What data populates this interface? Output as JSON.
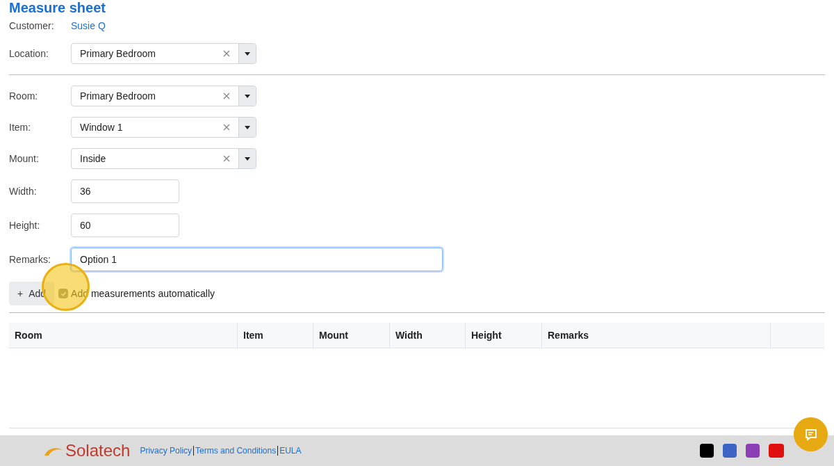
{
  "title": "Measure sheet",
  "customer": {
    "label": "Customer:",
    "value": "Susie Q"
  },
  "location": {
    "label": "Location:",
    "kind": "select",
    "value": "Primary Bedroom",
    "focused": false
  },
  "fields": [
    {
      "label": "Room:",
      "kind": "select",
      "value": "Primary Bedroom",
      "focused": false
    },
    {
      "label": "Item:",
      "kind": "select",
      "value": "Window 1",
      "focused": false
    },
    {
      "label": "Mount:",
      "kind": "select",
      "value": "Inside",
      "focused": false
    },
    {
      "label": "Width:",
      "kind": "short",
      "value": "36",
      "focused": false
    },
    {
      "label": "Height:",
      "kind": "short",
      "value": "60",
      "focused": false
    },
    {
      "label": "Remarks:",
      "kind": "long",
      "value": "Option 1",
      "focused": true
    }
  ],
  "add_button": {
    "icon": "+",
    "label": "Add"
  },
  "auto_checkbox": {
    "label": "Add measurements automatically",
    "checked": true
  },
  "table": {
    "columns": [
      "Room",
      "Item",
      "Mount",
      "Width",
      "Height",
      "Remarks"
    ]
  },
  "footer": {
    "logo": "Solatech",
    "links": [
      "Privacy Policy",
      "Terms and Conditions",
      "EULA"
    ]
  }
}
